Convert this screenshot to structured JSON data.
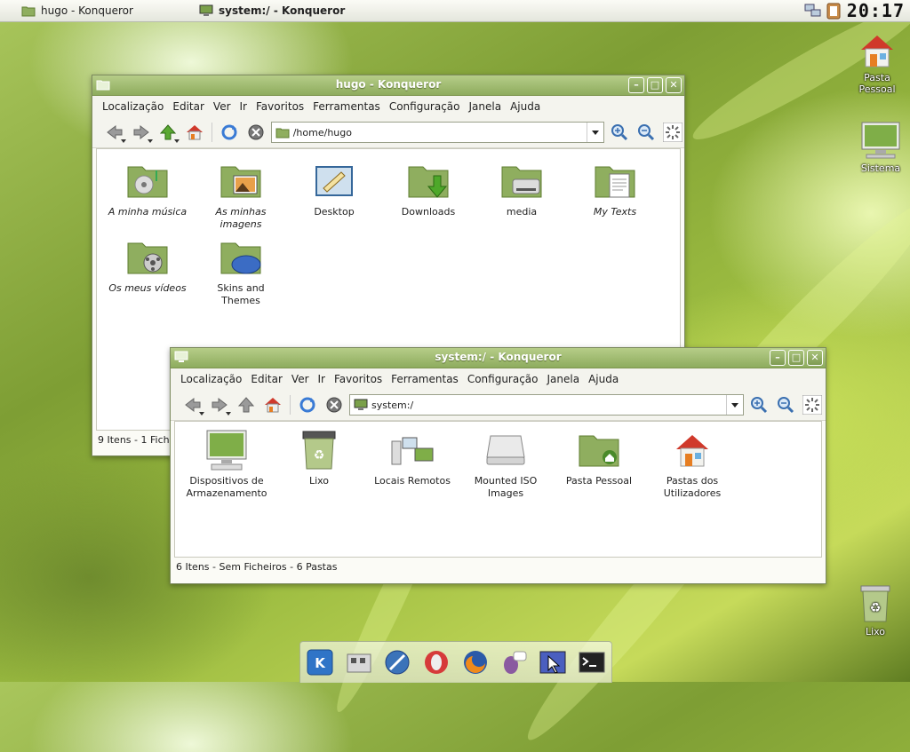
{
  "taskbar": {
    "tasks": [
      {
        "label": "hugo - Konqueror",
        "icon": "konqueror-folder-icon"
      },
      {
        "label": "system:/ - Konqueror",
        "icon": "computer-icon"
      }
    ],
    "clock": "20:17"
  },
  "desktop_icons": [
    {
      "label": "Pasta Pessoal",
      "icon": "home-folder-icon"
    },
    {
      "label": "Sistema",
      "icon": "computer-monitor-icon"
    },
    {
      "label": "Lixo",
      "icon": "trash-icon"
    }
  ],
  "window_home": {
    "title": "hugo - Konqueror",
    "menu": [
      "Localização",
      "Editar",
      "Ver",
      "Ir",
      "Favoritos",
      "Ferramentas",
      "Configuração",
      "Janela",
      "Ajuda"
    ],
    "location": "/home/hugo",
    "items": [
      {
        "label": "A minha música",
        "italic": true,
        "icon": "music-folder-icon"
      },
      {
        "label": "As minhas imagens",
        "italic": true,
        "icon": "pictures-folder-icon"
      },
      {
        "label": "Desktop",
        "italic": false,
        "icon": "desktop-folder-icon"
      },
      {
        "label": "Downloads",
        "italic": false,
        "icon": "downloads-folder-icon"
      },
      {
        "label": "media",
        "italic": false,
        "icon": "media-folder-icon"
      },
      {
        "label": "My Texts",
        "italic": true,
        "icon": "texts-folder-icon"
      },
      {
        "label": "Os meus vídeos",
        "italic": true,
        "icon": "videos-folder-icon"
      },
      {
        "label": "Skins and Themes",
        "italic": false,
        "icon": "themes-folder-icon"
      }
    ],
    "status": "9 Itens - 1 Fich"
  },
  "window_system": {
    "title": "system:/ - Konqueror",
    "menu": [
      "Localização",
      "Editar",
      "Ver",
      "Ir",
      "Favoritos",
      "Ferramentas",
      "Configuração",
      "Janela",
      "Ajuda"
    ],
    "location": "system:/",
    "items": [
      {
        "label": "Dispositivos de Armazenamento",
        "icon": "storage-devices-icon"
      },
      {
        "label": "Lixo",
        "icon": "trash-icon"
      },
      {
        "label": "Locais Remotos",
        "icon": "remote-places-icon"
      },
      {
        "label": "Mounted ISO Images",
        "icon": "iso-drive-icon"
      },
      {
        "label": "Pasta Pessoal",
        "icon": "home-folder-icon"
      },
      {
        "label": "Pastas dos Utilizadores",
        "icon": "users-folders-icon"
      }
    ],
    "status": "6 Itens - Sem Ficheiros - 6 Pastas"
  },
  "dock": [
    "kde-menu-icon",
    "file-manager-icon",
    "web-browser-icon",
    "opera-icon",
    "firefox-icon",
    "messenger-icon",
    "pointer-app-icon",
    "terminal-icon"
  ],
  "colors": {
    "accent": "#8eac5e",
    "folder": "#8fae5f"
  }
}
